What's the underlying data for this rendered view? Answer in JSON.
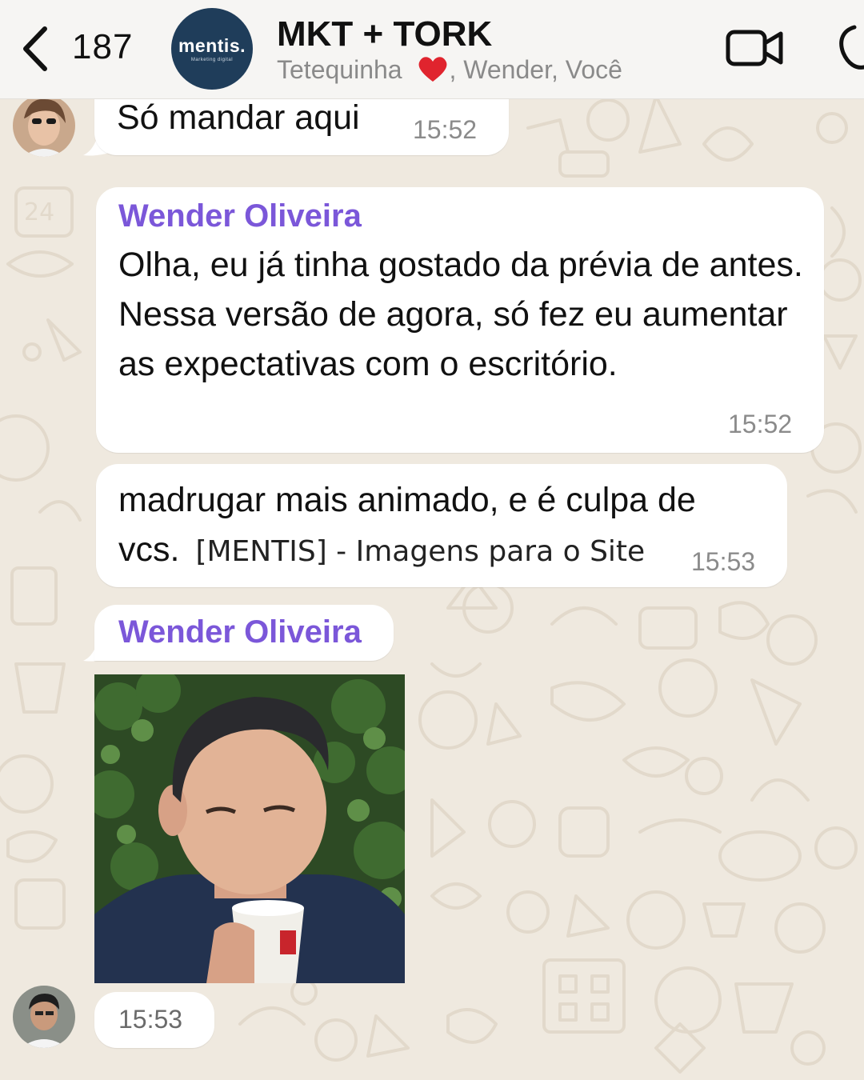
{
  "header": {
    "unread_count": "187",
    "group_logo": "mentis.",
    "group_logo_tagline": "Marketing digital",
    "title": "MKT + TORK",
    "members_prefix": "Tetequinha",
    "members_suffix": ", Wender, Você",
    "icons": [
      "chevron-left-icon",
      "video-call-icon",
      "phone-call-icon"
    ]
  },
  "messages": [
    {
      "text": "Só mandar aqui",
      "time": "15:52"
    },
    {
      "sender": "Wender Oliveira",
      "text": "Olha, eu já tinha gostado da prévia de antes. Nessa versão de agora, só fez eu aumentar as expectativas com o escritório.",
      "time": "15:52"
    },
    {
      "text_line1": "madrugar mais animado, e é culpa de",
      "text_line2": "vcs.",
      "link_label": "[MENTIS] - Imagens para o Site",
      "time": "15:53"
    },
    {
      "sender": "Wender Oliveira",
      "media": "image",
      "time": "15:53"
    }
  ],
  "colors": {
    "sender": "#7b57d9",
    "wallpaper": "#efe9df",
    "bubble": "#ffffff",
    "heart": "#e0242e"
  }
}
